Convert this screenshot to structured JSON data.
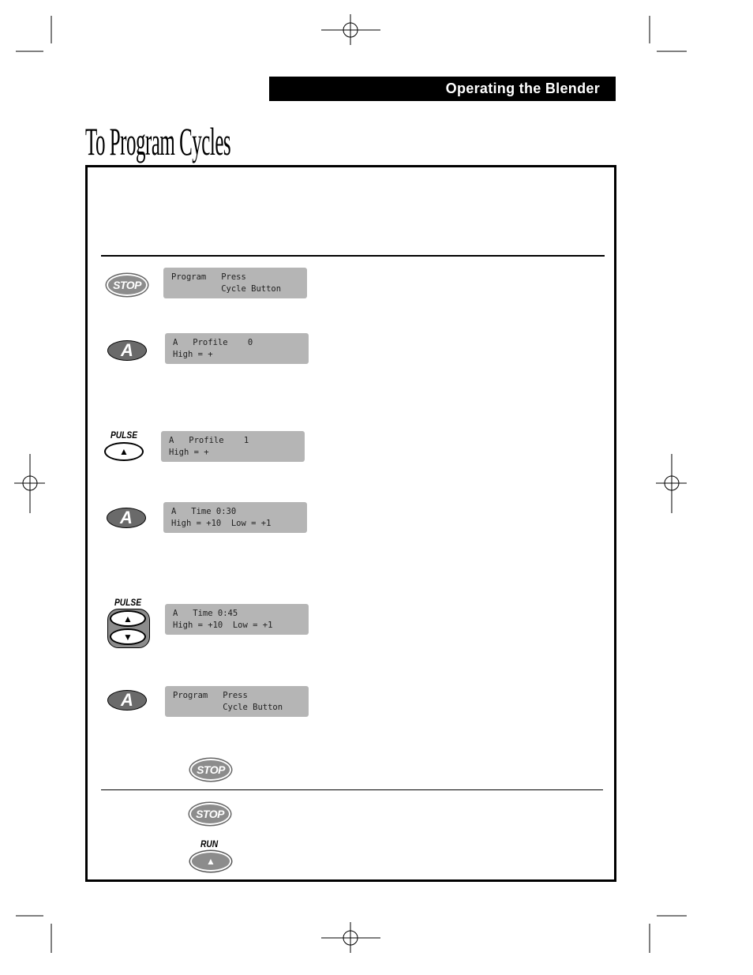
{
  "header": {
    "section": "Operating the Blender"
  },
  "title": "To Program Cycles",
  "steps": [
    {
      "button": "STOP",
      "lcd": [
        "Program   Press",
        "          Cycle Button"
      ]
    },
    {
      "button": "A",
      "lcd": [
        "A   Profile    0",
        "High = +"
      ]
    },
    {
      "button": "PULSE",
      "lcd": [
        "A   Profile    1",
        "High = +"
      ]
    },
    {
      "button": "A",
      "lcd": [
        "A   Time 0:30",
        "High = +10  Low = +1"
      ]
    },
    {
      "button": "PULSE",
      "lcd": [
        "A   Time 0:45",
        "High = +10  Low = +1"
      ]
    },
    {
      "button": "A",
      "lcd": [
        "Program   Press",
        "          Cycle Button"
      ]
    }
  ],
  "footer_buttons": {
    "stop1": "STOP",
    "stop2": "STOP",
    "run": "RUN"
  },
  "icons": {
    "up": "▲",
    "down": "▼"
  }
}
